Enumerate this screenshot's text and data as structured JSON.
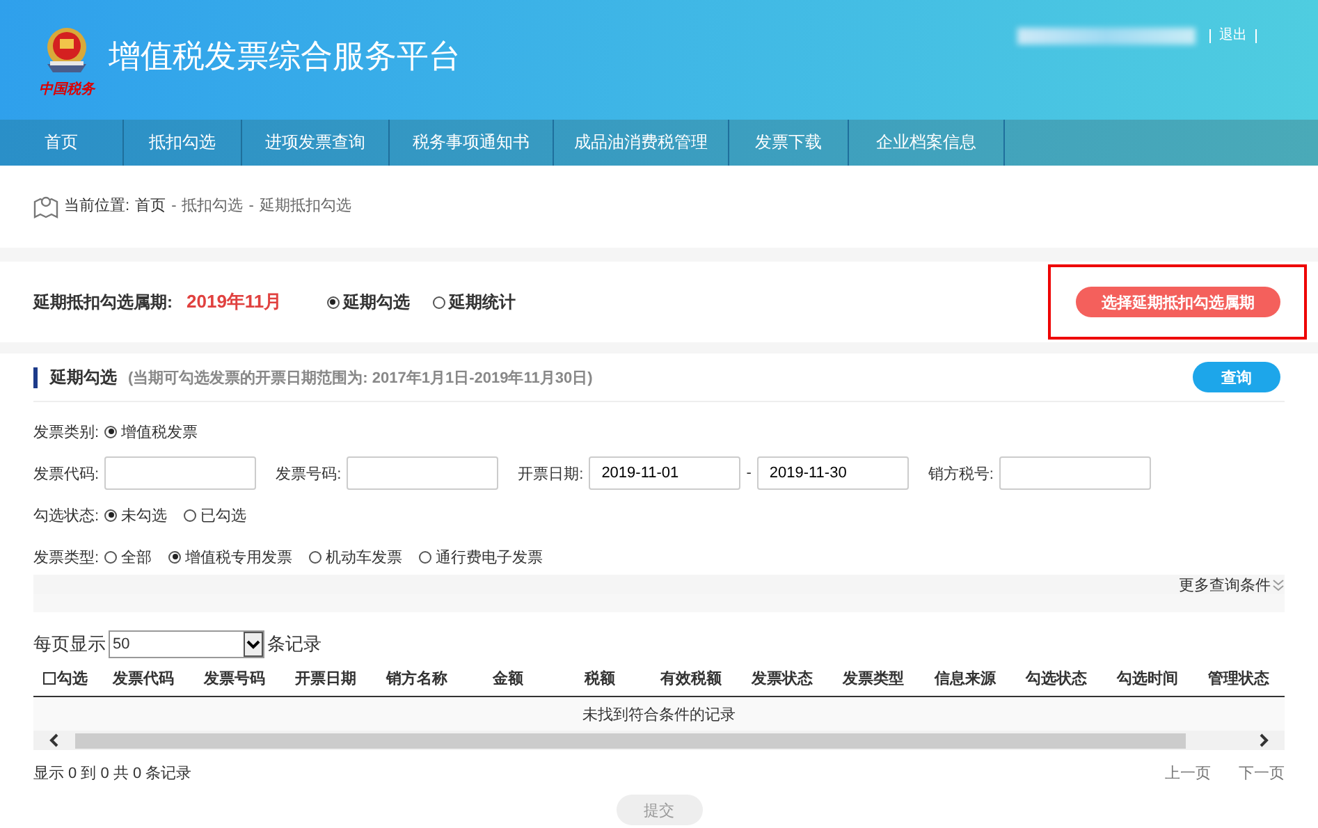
{
  "header": {
    "logo_caption": "中国税务",
    "title": "增值税发票综合服务平台",
    "logout": "退出"
  },
  "nav": {
    "items": [
      {
        "label": "首页"
      },
      {
        "label": "抵扣勾选"
      },
      {
        "label": "进项发票查询"
      },
      {
        "label": "税务事项通知书"
      },
      {
        "label": "成品油消费税管理"
      },
      {
        "label": "发票下载"
      },
      {
        "label": "企业档案信息"
      }
    ]
  },
  "breadcrumb": {
    "label": "当前位置:",
    "separator": "-",
    "path": [
      "首页",
      "抵扣勾选",
      "延期抵扣勾选"
    ]
  },
  "period": {
    "label": "延期抵扣勾选属期:",
    "value": "2019年11月",
    "modes": [
      {
        "label": "延期勾选",
        "selected": true
      },
      {
        "label": "延期统计",
        "selected": false
      }
    ],
    "button": {
      "label": "选择延期抵扣勾选属期",
      "highlighted": true
    }
  },
  "section": {
    "title": "延期勾选",
    "note": "(当期可勾选发票的开票日期范围为: 2017年1月1日-2019年11月30日)",
    "query_button": "查询"
  },
  "filters": {
    "category": {
      "label": "发票类别:",
      "options": [
        {
          "label": "增值税发票",
          "selected": true
        }
      ]
    },
    "fields": [
      {
        "kind": "text",
        "label": "发票代码:"
      },
      {
        "kind": "text",
        "label": "发票号码:"
      },
      {
        "kind": "date_range",
        "label": "开票日期:",
        "from": "2019-11-01",
        "separator": "-",
        "to": "2019-11-30"
      },
      {
        "kind": "text",
        "label": "销方税号:"
      }
    ],
    "check_status": {
      "label": "勾选状态:",
      "options": [
        {
          "label": "未勾选",
          "selected": true
        },
        {
          "label": "已勾选",
          "selected": false
        }
      ]
    },
    "invoice_type": {
      "label": "发票类型:",
      "options": [
        {
          "label": "全部",
          "selected": false
        },
        {
          "label": "增值税专用发票",
          "selected": true
        },
        {
          "label": "机动车发票",
          "selected": false
        },
        {
          "label": "通行费电子发票",
          "selected": false
        }
      ]
    },
    "more_conditions": "更多查询条件"
  },
  "page_size": {
    "label_before": "每页显示",
    "value": "50",
    "label_after": "条记录"
  },
  "table": {
    "columns": [
      {
        "kind": "checkbox",
        "label": "勾选",
        "checked": false
      },
      {
        "kind": "text",
        "label": "发票代码"
      },
      {
        "kind": "text",
        "label": "发票号码"
      },
      {
        "kind": "text",
        "label": "开票日期"
      },
      {
        "kind": "text",
        "label": "销方名称"
      },
      {
        "kind": "text",
        "label": "金额"
      },
      {
        "kind": "text",
        "label": "税额"
      },
      {
        "kind": "text",
        "label": "有效税额"
      },
      {
        "kind": "text",
        "label": "发票状态"
      },
      {
        "kind": "text",
        "label": "发票类型"
      },
      {
        "kind": "text",
        "label": "信息来源"
      },
      {
        "kind": "text",
        "label": "勾选状态"
      },
      {
        "kind": "text",
        "label": "勾选时间"
      },
      {
        "kind": "text",
        "label": "管理状态"
      }
    ],
    "empty_message": "未找到符合条件的记录"
  },
  "footer": {
    "info": "显示 0 到 0 共 0 条记录",
    "prev": "上一页",
    "next": "下一页",
    "submit": {
      "label": "提交",
      "disabled": true
    }
  }
}
